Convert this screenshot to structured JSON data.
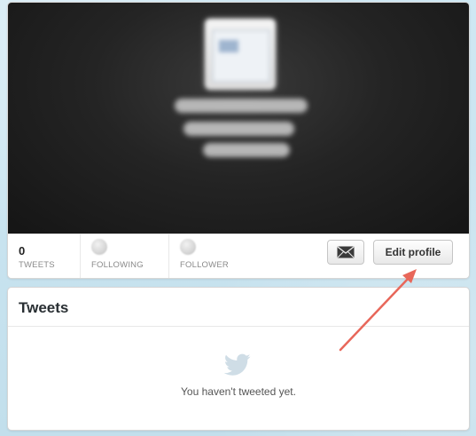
{
  "profile": {
    "stats": [
      {
        "key": "tweets",
        "count": "0",
        "label": "TWEETS"
      },
      {
        "key": "following",
        "count": "",
        "label": "FOLLOWING"
      },
      {
        "key": "follower",
        "count": "",
        "label": "FOLLOWER"
      }
    ],
    "buttons": {
      "message_icon": "envelope-icon",
      "edit_label": "Edit profile"
    }
  },
  "tweets": {
    "title": "Tweets",
    "empty_icon": "twitter-bird-icon",
    "empty_message": "You haven't tweeted yet."
  },
  "colors": {
    "page_background": "#c7e3ef",
    "banner": "#242424",
    "annotation_arrow": "#e8675a"
  }
}
